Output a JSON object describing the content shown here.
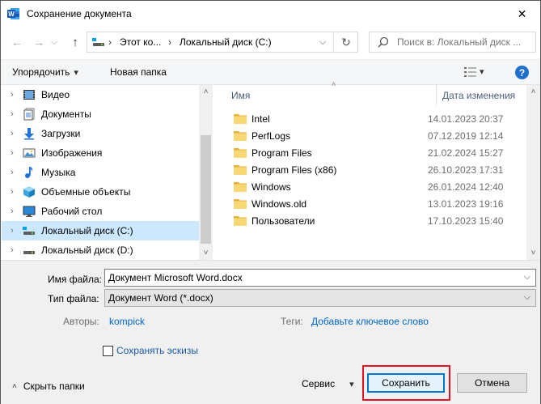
{
  "window": {
    "title": "Сохранение документа",
    "close_glyph": "✕"
  },
  "nav": {
    "back_glyph": "←",
    "forward_glyph": "→",
    "recent_glyph": "⌵",
    "up_glyph": "↑",
    "address": {
      "segments": [
        "Этот ко...",
        "Локальный диск (C:)"
      ],
      "separator": "›"
    },
    "refresh_glyph": "↻",
    "search_placeholder": "Поиск в: Локальный диск ..."
  },
  "toolbar": {
    "organize_label": "Упорядочить",
    "organize_caret": "▾",
    "new_folder_label": "Новая папка",
    "view_caret": "▾",
    "help_glyph": "?"
  },
  "tree": [
    {
      "label": "Видео",
      "icon": "video-icon",
      "selected": false
    },
    {
      "label": "Документы",
      "icon": "documents-icon",
      "selected": false
    },
    {
      "label": "Загрузки",
      "icon": "downloads-icon",
      "selected": false
    },
    {
      "label": "Изображения",
      "icon": "pictures-icon",
      "selected": false
    },
    {
      "label": "Музыка",
      "icon": "music-icon",
      "selected": false
    },
    {
      "label": "Объемные объекты",
      "icon": "3d-objects-icon",
      "selected": false
    },
    {
      "label": "Рабочий стол",
      "icon": "desktop-icon",
      "selected": false
    },
    {
      "label": "Локальный диск (C:)",
      "icon": "system-drive-icon",
      "selected": true
    },
    {
      "label": "Локальный диск (D:)",
      "icon": "drive-icon",
      "selected": false
    }
  ],
  "tree_chevron": "›",
  "scroll": {
    "up": "˄",
    "down": "˅"
  },
  "list": {
    "columns": {
      "name": "Имя",
      "modified": "Дата изменения"
    },
    "sort_glyph": "˄",
    "rows": [
      {
        "name": "Intel",
        "modified": "14.01.2023 20:37"
      },
      {
        "name": "PerfLogs",
        "modified": "07.12.2019 12:14"
      },
      {
        "name": "Program Files",
        "modified": "21.02.2024 15:27"
      },
      {
        "name": "Program Files (x86)",
        "modified": "26.10.2023 17:31"
      },
      {
        "name": "Windows",
        "modified": "26.01.2024 12:40"
      },
      {
        "name": "Windows.old",
        "modified": "13.01.2023 19:16"
      },
      {
        "name": "Пользователи",
        "modified": "17.10.2023 15:40"
      }
    ]
  },
  "form": {
    "filename_label": "Имя файла:",
    "filename_value": "Документ Microsoft Word.docx",
    "filetype_label": "Тип файла:",
    "filetype_value": "Документ Word (*.docx)",
    "authors_label": "Авторы:",
    "authors_value": "kompick",
    "tags_label": "Теги:",
    "tags_value": "Добавьте ключевое слово",
    "thumbnails_label": "Сохранять эскизы",
    "dropdown_glyph": "⌵"
  },
  "footer": {
    "hide_folders_label": "Скрыть папки",
    "hide_glyph": "˄",
    "tools_label": "Сервис",
    "tools_caret": "▾",
    "save_label": "Сохранить",
    "cancel_label": "Отмена"
  },
  "colors": {
    "accent": "#0078d7",
    "selection": "#cce8ff",
    "highlight_box": "#e81123",
    "folder": "#f8d775"
  }
}
